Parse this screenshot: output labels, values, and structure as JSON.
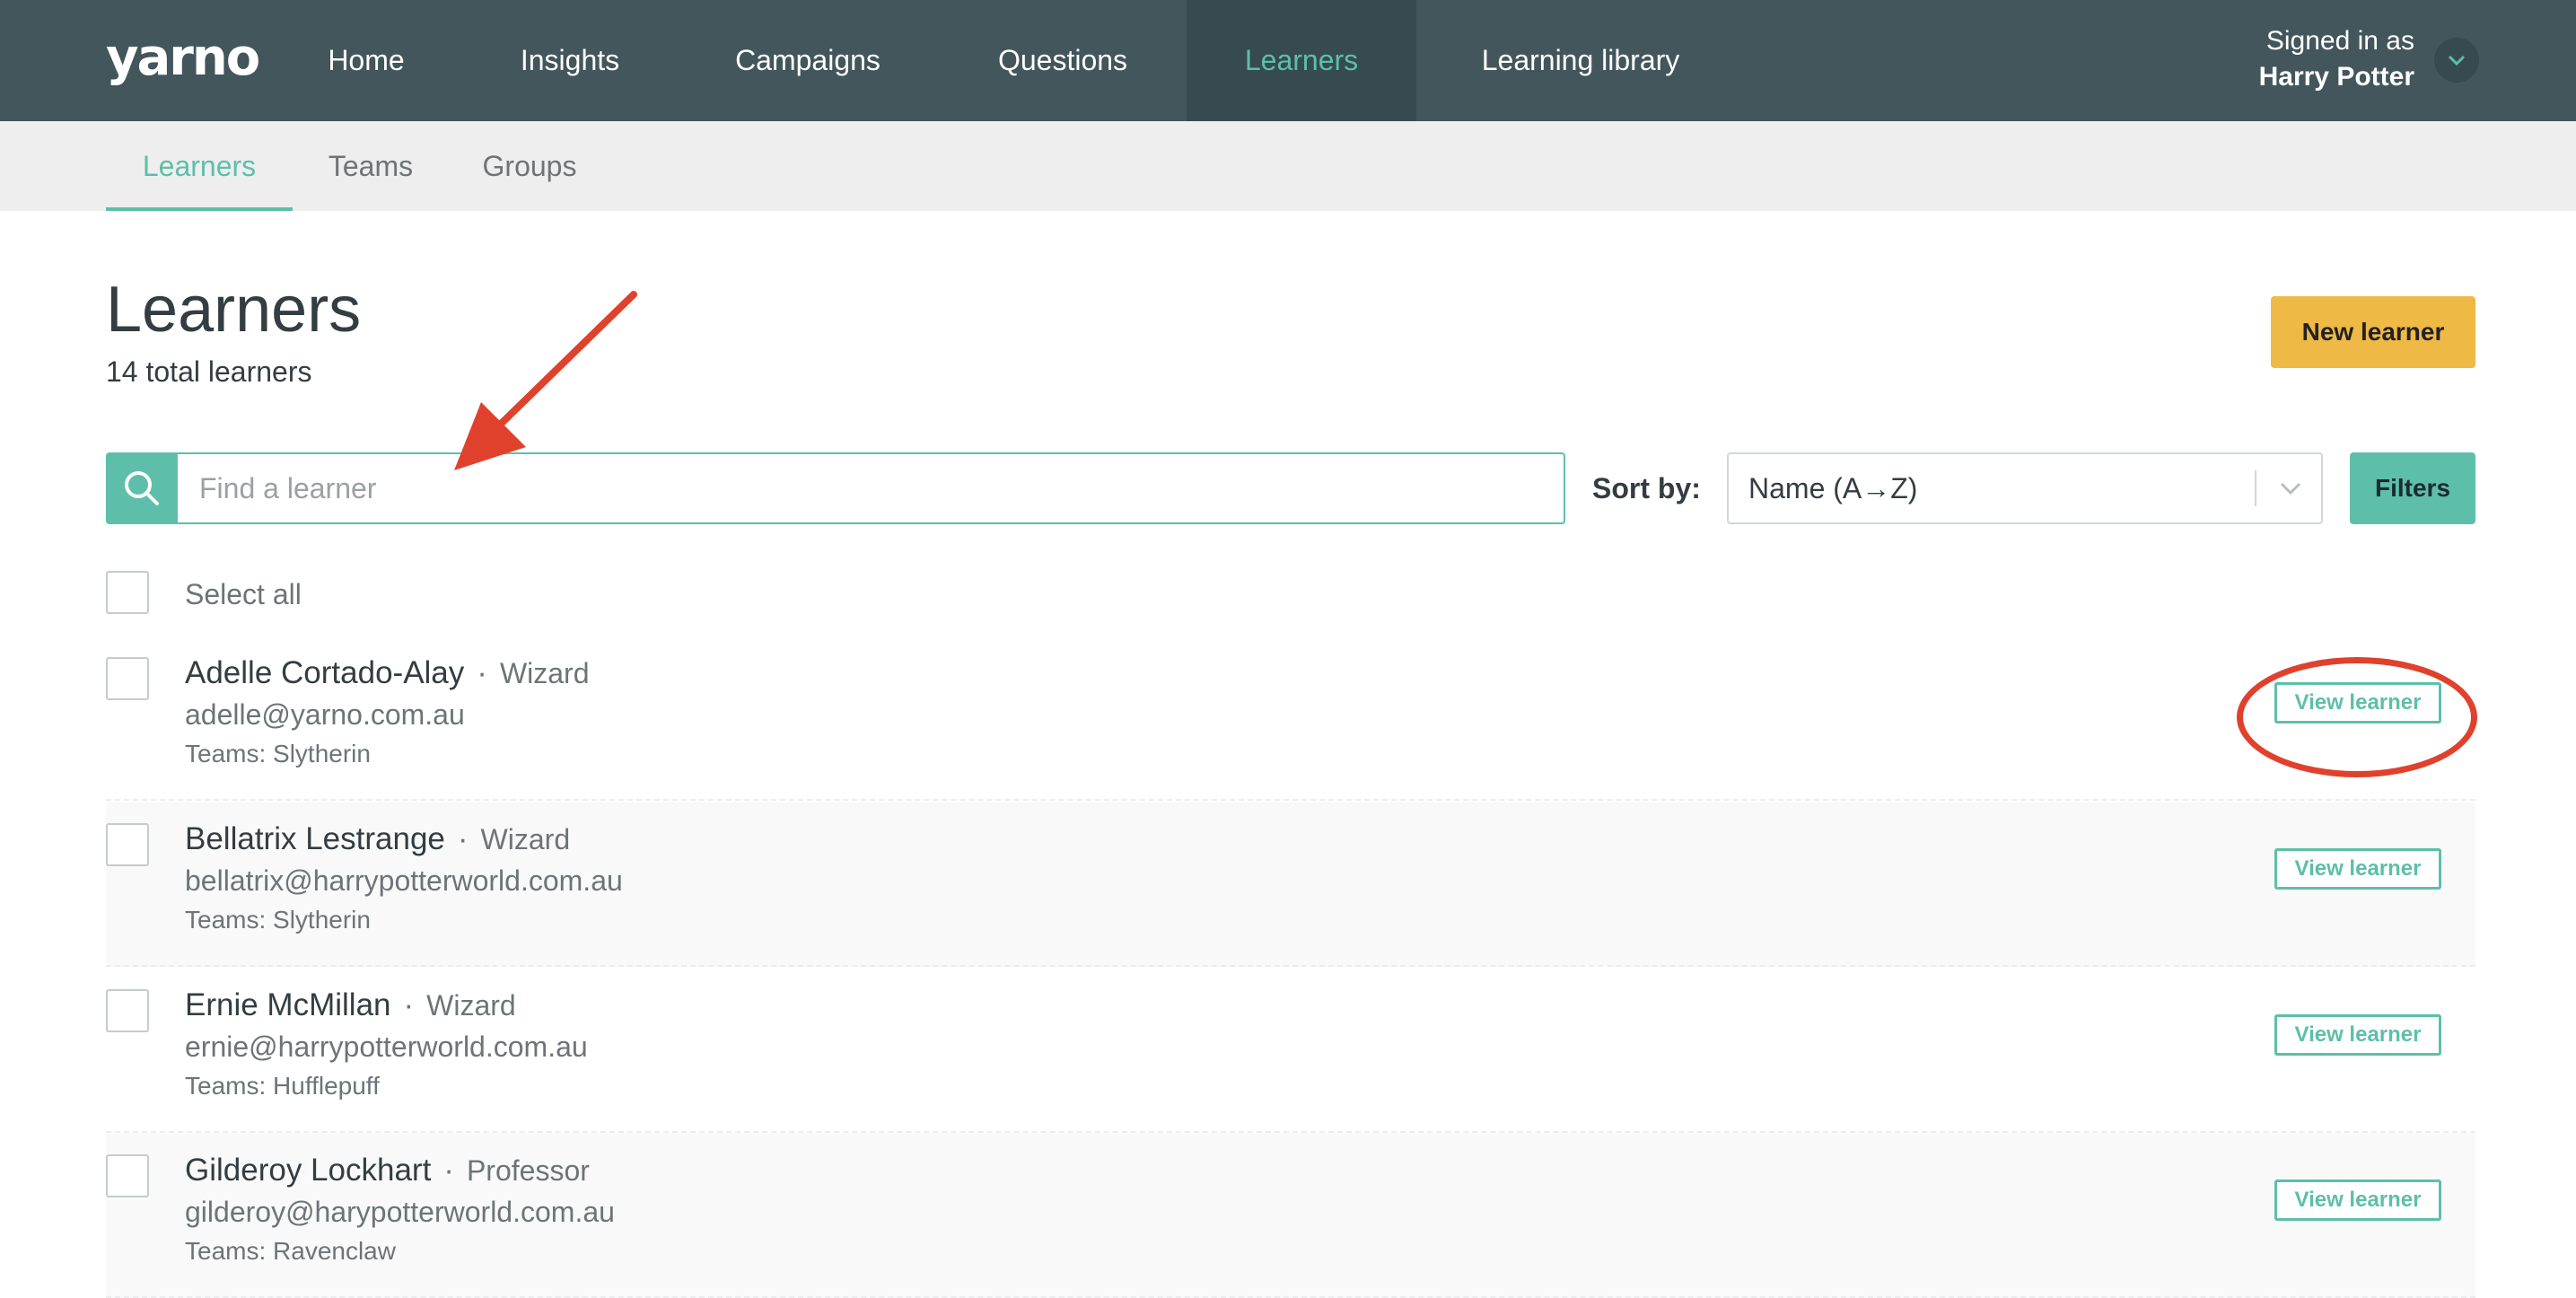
{
  "app": {
    "logo": "yarno"
  },
  "nav": {
    "items": [
      {
        "label": "Home"
      },
      {
        "label": "Insights"
      },
      {
        "label": "Campaigns"
      },
      {
        "label": "Questions"
      },
      {
        "label": "Learners",
        "active": true
      },
      {
        "label": "Learning library"
      }
    ]
  },
  "user": {
    "signed_in_label": "Signed in as",
    "name": "Harry Potter"
  },
  "subnav": {
    "items": [
      {
        "label": "Learners",
        "active": true
      },
      {
        "label": "Teams"
      },
      {
        "label": "Groups"
      }
    ]
  },
  "page": {
    "title": "Learners",
    "total": "14 total learners",
    "new_button": "New learner"
  },
  "search": {
    "placeholder": "Find a learner",
    "value": ""
  },
  "sort": {
    "label": "Sort by:",
    "selected": "Name (A→Z)"
  },
  "filters": {
    "label": "Filters"
  },
  "select_all": {
    "label": "Select all"
  },
  "learners": [
    {
      "name": "Adelle Cortado-Alay",
      "role": "Wizard",
      "email": "adelle@yarno.com.au",
      "teams": "Teams: Slytherin",
      "action": "View learner"
    },
    {
      "name": "Bellatrix Lestrange",
      "role": "Wizard",
      "email": "bellatrix@harrypotterworld.com.au",
      "teams": "Teams: Slytherin",
      "action": "View learner"
    },
    {
      "name": "Ernie McMillan",
      "role": "Wizard",
      "email": "ernie@harrypotterworld.com.au",
      "teams": "Teams: Hufflepuff",
      "action": "View learner"
    },
    {
      "name": "Gilderoy Lockhart",
      "role": "Professor",
      "email": "gilderoy@harypotterworld.com.au",
      "teams": "Teams: Ravenclaw",
      "action": "View learner"
    }
  ],
  "colors": {
    "nav_bg": "#42565c",
    "accent": "#5dbfa9",
    "primary_button": "#efb946",
    "annotation": "#e0412c"
  },
  "icons": {
    "search": "search-icon",
    "user_menu": "chevron-down-icon",
    "sort": "chevron-down-icon"
  }
}
